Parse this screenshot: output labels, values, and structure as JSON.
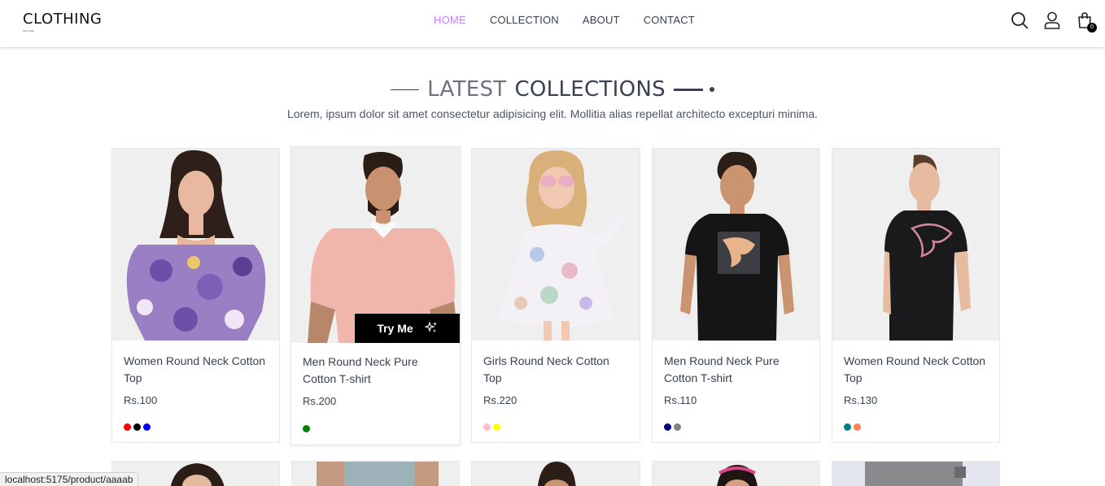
{
  "header": {
    "logo": "CLOTHING",
    "logo_tag": "WE LOVE",
    "nav": [
      {
        "label": "HOME",
        "active": true
      },
      {
        "label": "COLLECTION",
        "active": false
      },
      {
        "label": "ABOUT",
        "active": false
      },
      {
        "label": "CONTACT",
        "active": false
      }
    ],
    "icons": [
      "search-icon",
      "user-icon",
      "cart-icon"
    ],
    "cart_count": "0",
    "accent_color": "#c084fc"
  },
  "section": {
    "title_light": "LATEST",
    "title_dark": "COLLECTIONS",
    "subtitle": "Lorem, ipsum dolor sit amet consectetur adipisicing elit. Mollitia alias repellat architecto excepturi minima."
  },
  "products": [
    {
      "name": "Women Round Neck Cotton Top",
      "price": "Rs.100",
      "colors": [
        "#ff0000",
        "#000000",
        "#0000ff"
      ],
      "image": "woman-floral-top"
    },
    {
      "name": "Men Round Neck Pure Cotton T-shirt",
      "price": "Rs.200",
      "colors": [
        "#008000"
      ],
      "image": "man-pink-polo",
      "try_me": "Try Me"
    },
    {
      "name": "Girls Round Neck Cotton Top",
      "price": "Rs.220",
      "colors": [
        "#ffc0cb",
        "#ffff00"
      ],
      "image": "girl-floral-dress"
    },
    {
      "name": "Men Round Neck Pure Cotton T-shirt",
      "price": "Rs.110",
      "colors": [
        "#000080",
        "#808080"
      ],
      "image": "man-black-tee"
    },
    {
      "name": "Women Round Neck Cotton Top",
      "price": "Rs.130",
      "colors": [
        "#008080",
        "#ff7f50"
      ],
      "image": "woman-black-tee"
    }
  ],
  "status_bar": "localhost:5175/product/aaaab"
}
